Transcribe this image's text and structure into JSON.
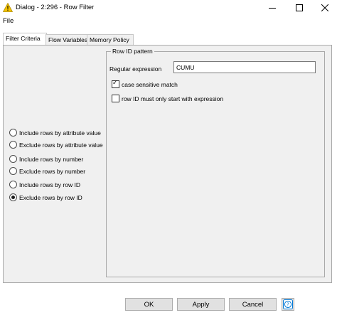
{
  "window": {
    "title": "Dialog - 2:296 - Row Filter",
    "icons": [
      "warning-icon",
      "minimize-icon",
      "maximize-icon",
      "close-icon"
    ]
  },
  "menu": {
    "file": "File"
  },
  "tabs": [
    {
      "label": "Filter Criteria",
      "active": true
    },
    {
      "label": "Flow Variables",
      "active": false
    },
    {
      "label": "Memory Policy",
      "active": false
    }
  ],
  "options": [
    {
      "label": "Include rows by attribute value",
      "selected": false
    },
    {
      "label": "Exclude rows by attribute value",
      "selected": false
    },
    {
      "label": "Include rows by number",
      "selected": false
    },
    {
      "label": "Exclude rows by number",
      "selected": false
    },
    {
      "label": "Include rows by row ID",
      "selected": false
    },
    {
      "label": "Exclude rows by row ID",
      "selected": true
    }
  ],
  "row_id_pattern": {
    "legend": "Row ID pattern",
    "regex_label": "Regular expression",
    "regex_value": "CUMU",
    "case_sensitive_label": "case sensitive match",
    "case_sensitive_checked": true,
    "start_only_label": "row ID must only start with expression",
    "start_only_checked": false
  },
  "buttons": {
    "ok": "OK",
    "apply": "Apply",
    "cancel": "Cancel",
    "help_icon": "help-icon"
  },
  "colors": {
    "accent": "#0078d7",
    "warning": "#f3c300",
    "panel": "#f0f0f0"
  }
}
